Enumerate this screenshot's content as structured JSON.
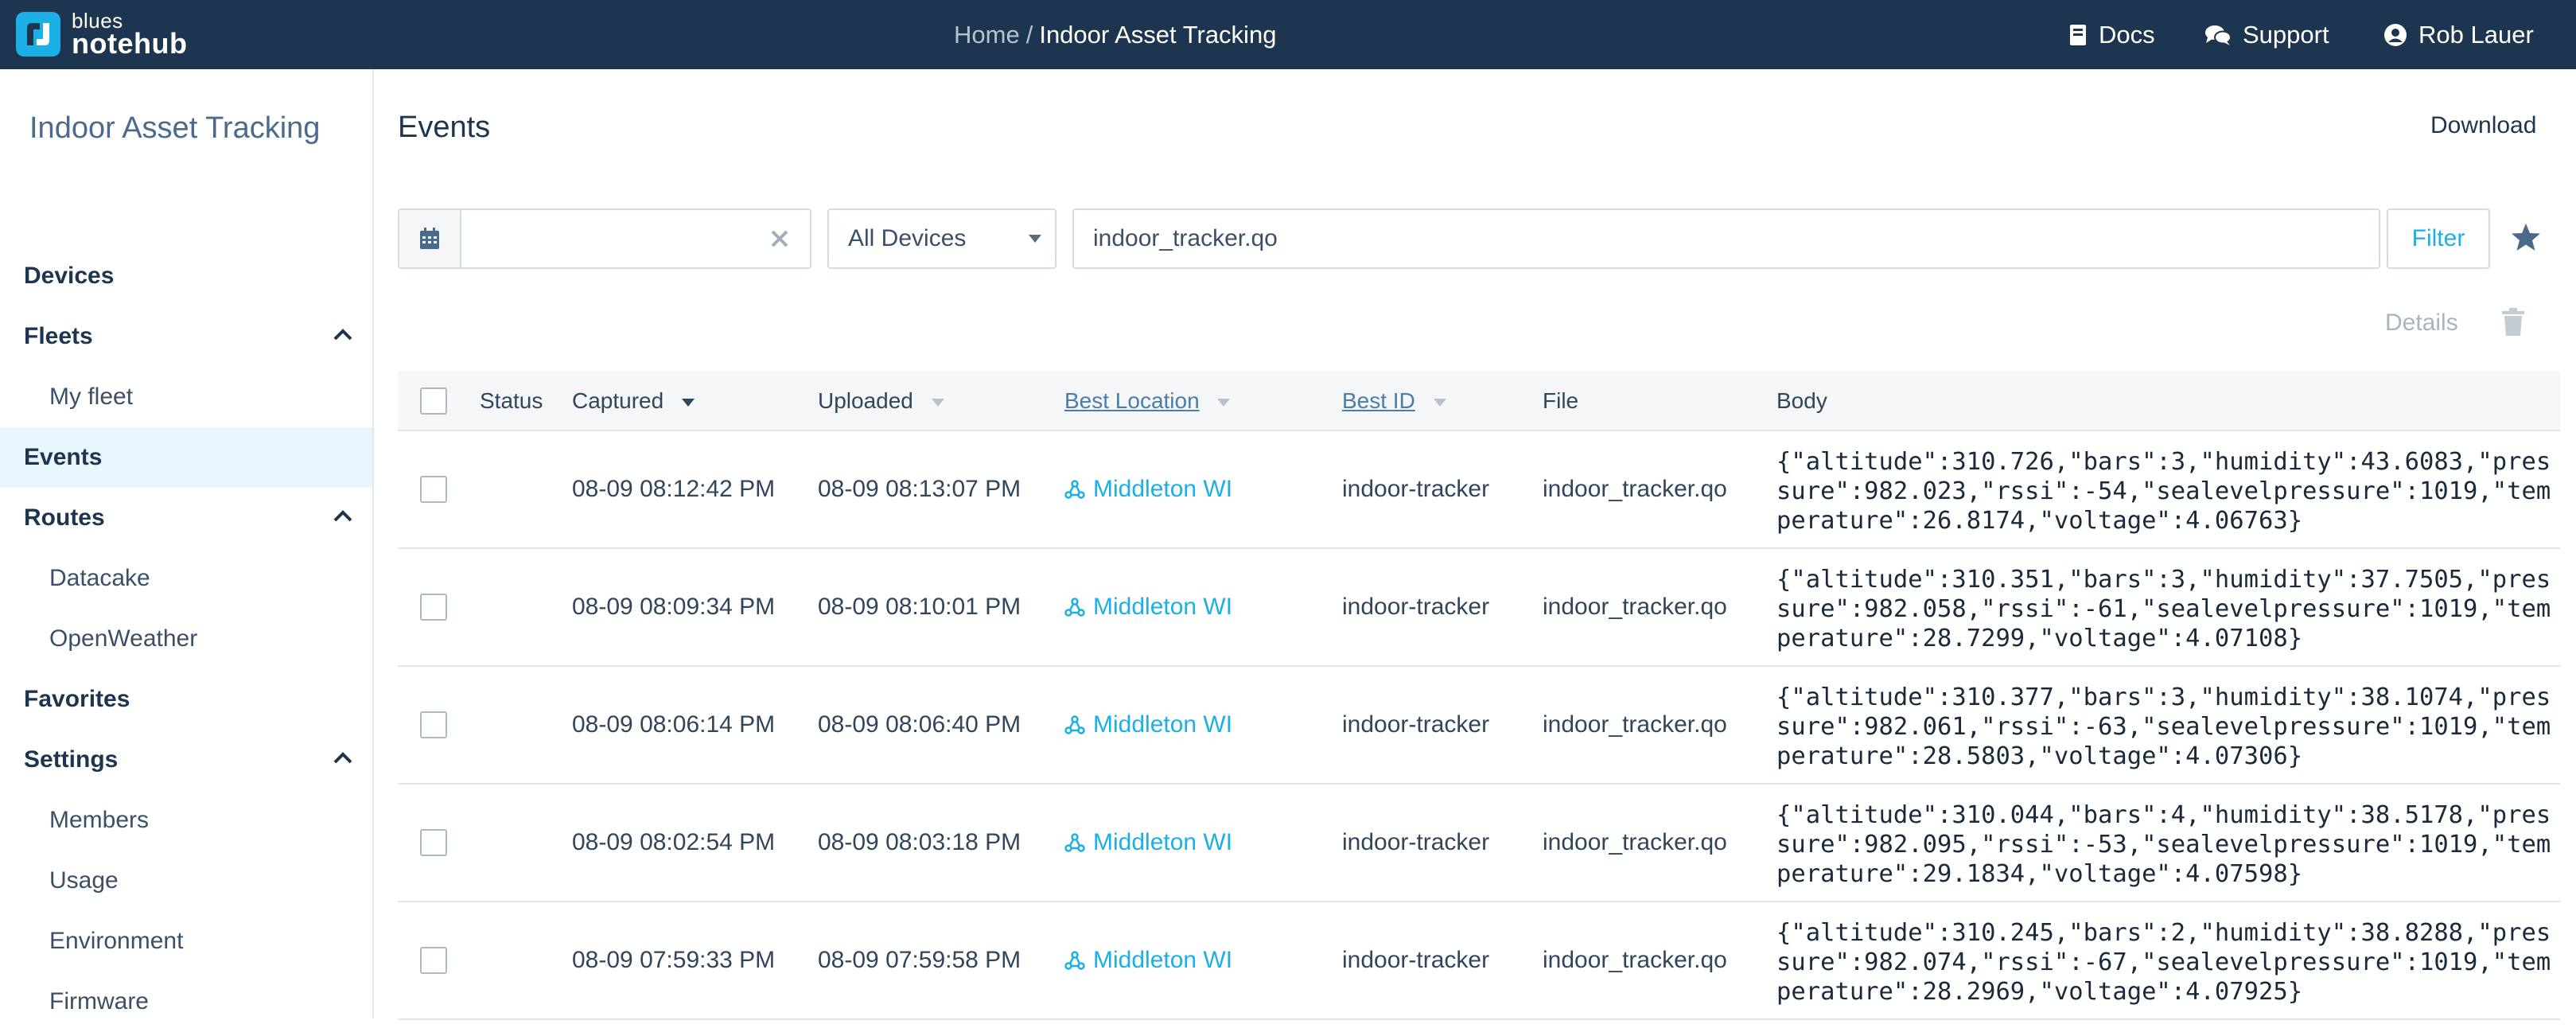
{
  "topbar": {
    "logo_small": "blues",
    "logo_big": "notehub",
    "breadcrumb_home": "Home",
    "breadcrumb_sep": "/",
    "breadcrumb_current": "Indoor Asset Tracking",
    "docs": "Docs",
    "support": "Support",
    "user": "Rob Lauer"
  },
  "sidebar": {
    "project_title": "Indoor Asset Tracking",
    "devices": "Devices",
    "fleets": "Fleets",
    "my_fleet": "My fleet",
    "events": "Events",
    "routes": "Routes",
    "datacake": "Datacake",
    "openweather": "OpenWeather",
    "favorites": "Favorites",
    "settings": "Settings",
    "members": "Members",
    "usage": "Usage",
    "environment": "Environment",
    "firmware": "Firmware"
  },
  "main": {
    "title": "Events",
    "download": "Download",
    "date_value": "",
    "device_select": "All Devices",
    "search_value": "indoor_tracker.qo",
    "filter": "Filter",
    "details": "Details"
  },
  "table": {
    "headers": {
      "status": "Status",
      "captured": "Captured",
      "uploaded": "Uploaded",
      "best_location": "Best Location",
      "best_id": "Best ID",
      "file": "File",
      "body": "Body"
    },
    "rows": [
      {
        "status": "",
        "captured": "08-09 08:12:42 PM",
        "uploaded": "08-09 08:13:07 PM",
        "location": "Middleton WI",
        "best_id": "indoor-tracker",
        "file": "indoor_tracker.qo",
        "body": "{\"altitude\":310.726,\"bars\":3,\"humidity\":43.6083,\"pressure\":982.023,\"rssi\":-54,\"sealevelpressure\":1019,\"temperature\":26.8174,\"voltage\":4.06763}"
      },
      {
        "status": "",
        "captured": "08-09 08:09:34 PM",
        "uploaded": "08-09 08:10:01 PM",
        "location": "Middleton WI",
        "best_id": "indoor-tracker",
        "file": "indoor_tracker.qo",
        "body": "{\"altitude\":310.351,\"bars\":3,\"humidity\":37.7505,\"pressure\":982.058,\"rssi\":-61,\"sealevelpressure\":1019,\"temperature\":28.7299,\"voltage\":4.07108}"
      },
      {
        "status": "",
        "captured": "08-09 08:06:14 PM",
        "uploaded": "08-09 08:06:40 PM",
        "location": "Middleton WI",
        "best_id": "indoor-tracker",
        "file": "indoor_tracker.qo",
        "body": "{\"altitude\":310.377,\"bars\":3,\"humidity\":38.1074,\"pressure\":982.061,\"rssi\":-63,\"sealevelpressure\":1019,\"temperature\":28.5803,\"voltage\":4.07306}"
      },
      {
        "status": "",
        "captured": "08-09 08:02:54 PM",
        "uploaded": "08-09 08:03:18 PM",
        "location": "Middleton WI",
        "best_id": "indoor-tracker",
        "file": "indoor_tracker.qo",
        "body": "{\"altitude\":310.044,\"bars\":4,\"humidity\":38.5178,\"pressure\":982.095,\"rssi\":-53,\"sealevelpressure\":1019,\"temperature\":29.1834,\"voltage\":4.07598}"
      },
      {
        "status": "",
        "captured": "08-09 07:59:33 PM",
        "uploaded": "08-09 07:59:58 PM",
        "location": "Middleton WI",
        "best_id": "indoor-tracker",
        "file": "indoor_tracker.qo",
        "body": "{\"altitude\":310.245,\"bars\":2,\"humidity\":38.8288,\"pressure\":982.074,\"rssi\":-67,\"sealevelpressure\":1019,\"temperature\":28.2969,\"voltage\":4.07925}"
      }
    ]
  },
  "colors": {
    "topbar_bg": "#1e3550",
    "accent": "#1ab0e6",
    "active_bg": "#e9f6fd"
  },
  "icons": {
    "logo": "notehub-logo-icon",
    "docs": "book-icon",
    "support": "chat-bubbles-icon",
    "user": "user-circle-icon",
    "calendar": "calendar-icon",
    "clear": "close-icon",
    "favorite": "star-icon",
    "delete": "trash-icon",
    "location": "location-tri-icon"
  }
}
